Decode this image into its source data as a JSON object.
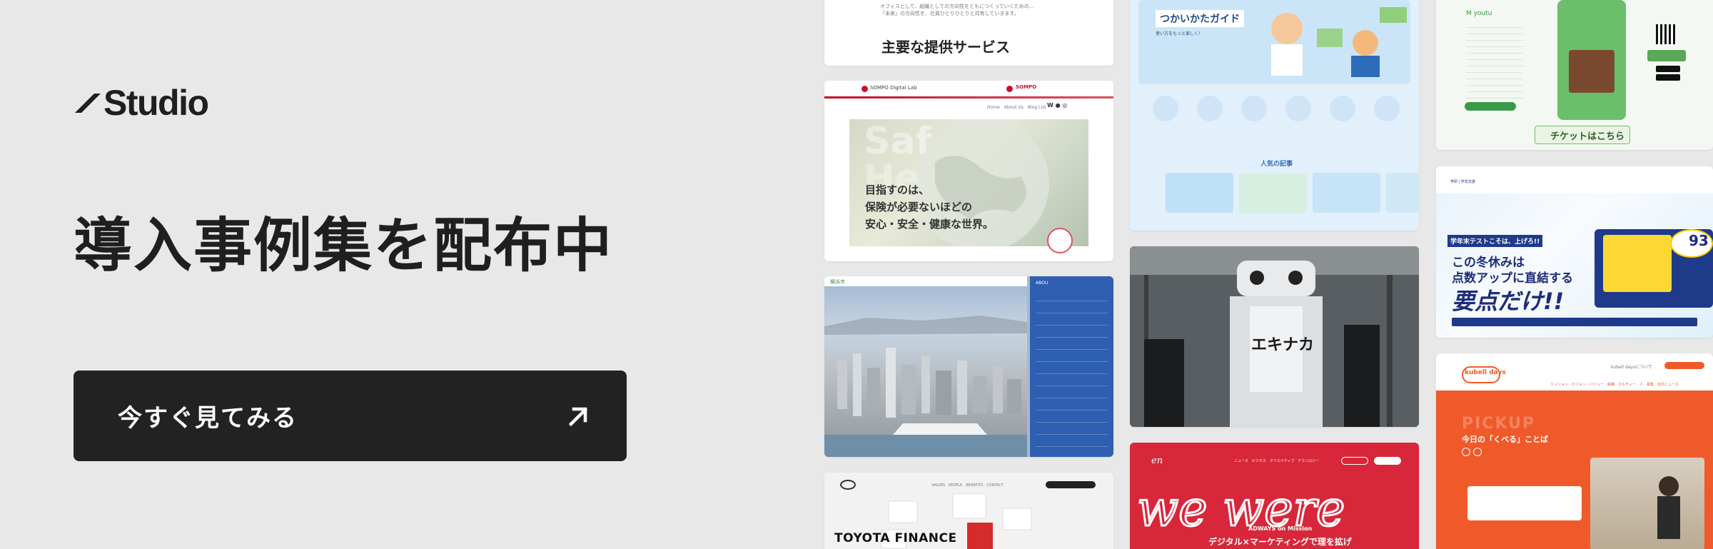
{
  "logo": {
    "text": "Studio"
  },
  "headline": "導入事例集を配布中",
  "cta": {
    "label": "今すぐ見てみる"
  },
  "cards": {
    "services": {
      "heading": "主要な提供サービス"
    },
    "sompo": {
      "brand1": "SOMPO Digital Lab",
      "brand2": "SOMPO",
      "hero_text_1": "目指すのは、",
      "hero_text_2": "保険が必要ないほどの",
      "hero_text_3": "安心・安全・健康な世界。"
    },
    "toyota": {
      "brand": "TOYOTA FINANCE"
    },
    "guide": {
      "title": "つかいかたガイド",
      "section": "人気の記事"
    },
    "adways": {
      "mission": "ADWAYS on Mission",
      "tagline": "デジタル×マーケティングで理を拡げ",
      "script": "we were"
    },
    "test": {
      "badge": "学年末テストこそは、上げろ!!",
      "line1": "この冬休みは",
      "line2": "点数アップに直結する",
      "line3": "要点だけ!!",
      "score": "93"
    },
    "kubell": {
      "brand": "kubell days",
      "pickup": "PICKUP",
      "subtitle": "今日の「くべる」ことば"
    },
    "app": {
      "ticket": "チケットはこちら"
    },
    "robot": {
      "text": "エキナカ"
    }
  }
}
